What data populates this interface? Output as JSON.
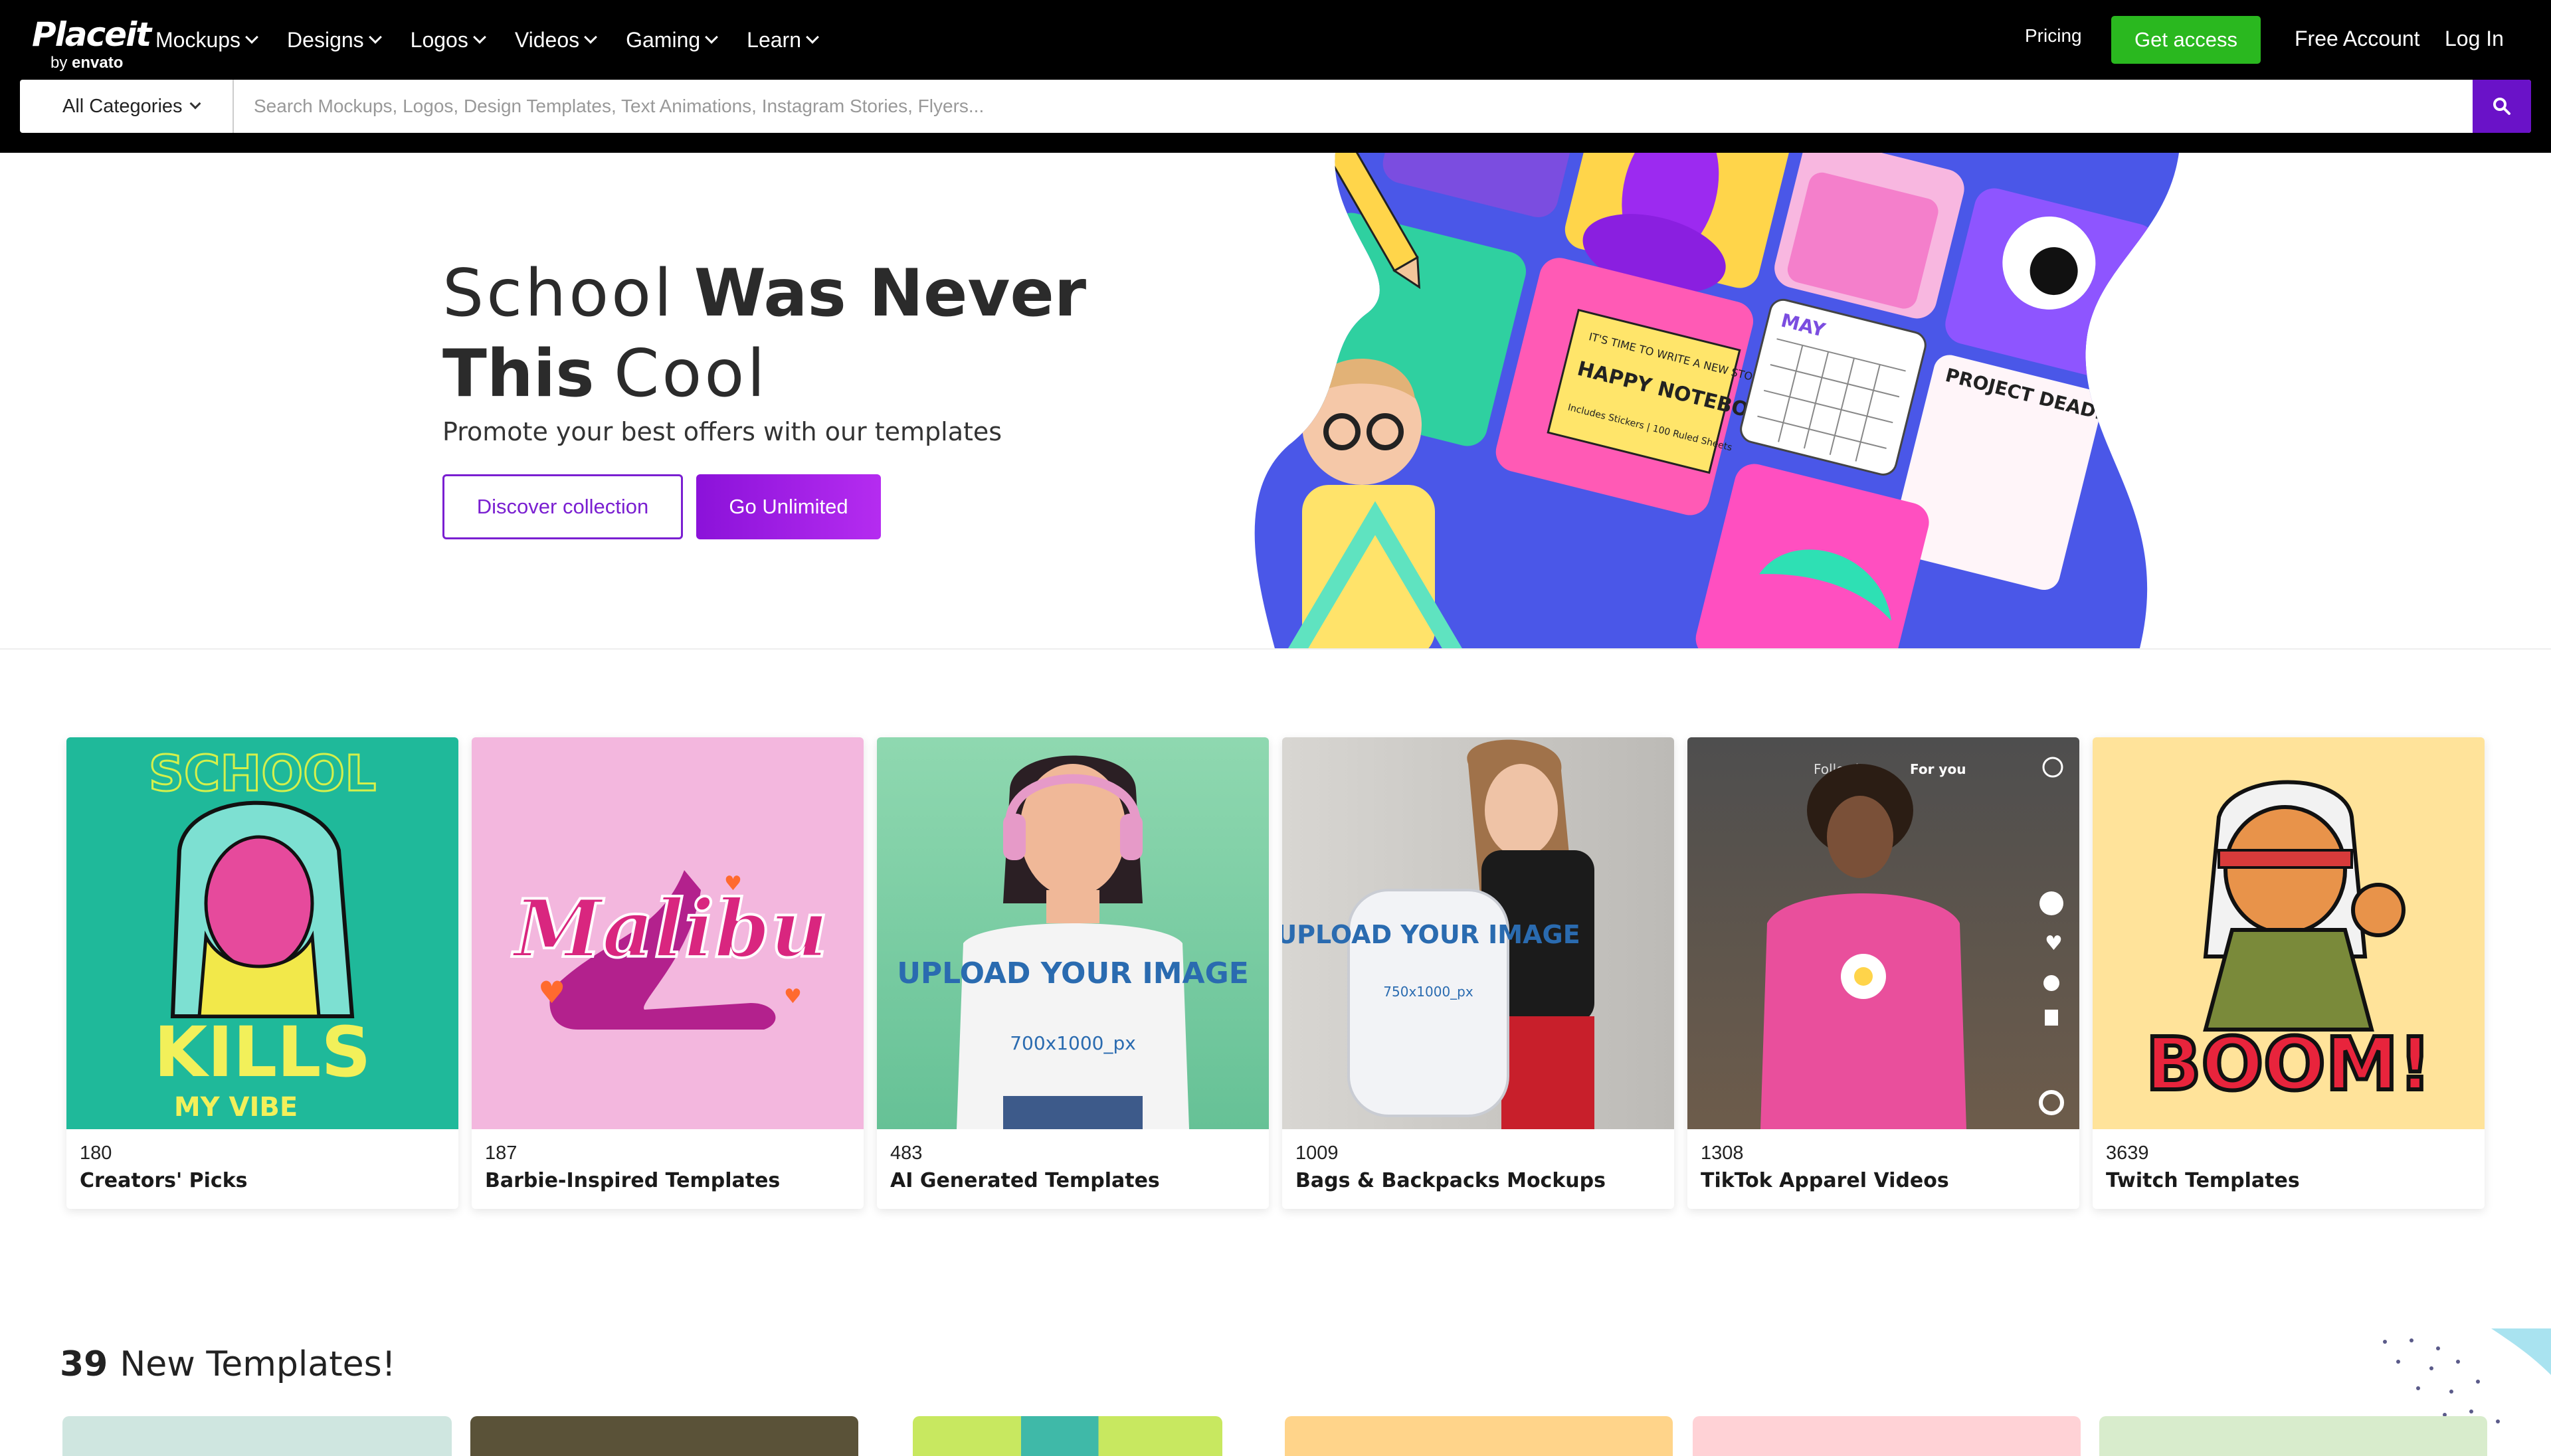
{
  "header": {
    "logo_main": "Placeit",
    "logo_by": "by",
    "logo_brand": "envato",
    "nav": [
      {
        "label": "Mockups"
      },
      {
        "label": "Designs"
      },
      {
        "label": "Logos"
      },
      {
        "label": "Videos"
      },
      {
        "label": "Gaming"
      },
      {
        "label": "Learn"
      }
    ],
    "pricing": "Pricing",
    "get_access": "Get access",
    "free_account": "Free Account",
    "login": "Log In"
  },
  "search": {
    "category": "All Categories",
    "placeholder": "Search Mockups, Logos, Design Templates, Text Animations, Instagram Stories, Flyers..."
  },
  "hero": {
    "title_light_1": "School",
    "title_bold_1": "Was Never",
    "title_bold_2": "This",
    "title_light_2": "Cool",
    "subtitle": "Promote your best offers with our templates",
    "btn_discover": "Discover collection",
    "btn_unlimited": "Go Unlimited",
    "art_labels": {
      "notebook_1": "IT'S TIME TO WRITE A NEW STORY",
      "notebook_2": "HAPPY NOTEBOOK",
      "notebook_3": "Includes Stickers | 100 Ruled Sheets",
      "calendar": "MAY",
      "project": "PROJECT DEADLINE"
    }
  },
  "categories": [
    {
      "count": "180",
      "name": "Creators' Picks",
      "art_top": "SCHOOL",
      "art_main": "KILLS",
      "art_sub": "MY VIBE"
    },
    {
      "count": "187",
      "name": "Barbie-Inspired Templates",
      "art_main": "Malibu"
    },
    {
      "count": "483",
      "name": "AI Generated Templates",
      "art_main": "UPLOAD YOUR IMAGE",
      "art_sub": "700x1000_px"
    },
    {
      "count": "1009",
      "name": "Bags & Backpacks Mockups",
      "art_main": "UPLOAD YOUR IMAGE",
      "art_sub": "750x1000_px"
    },
    {
      "count": "1308",
      "name": "TikTok Apparel Videos",
      "art_main": "Following",
      "art_sub": "For you"
    },
    {
      "count": "3639",
      "name": "Twitch Templates",
      "art_main": "BOOM!"
    }
  ],
  "new_templates": {
    "count": "39",
    "label": "New Templates!"
  },
  "colors": {
    "brand_green": "#2ab81f",
    "brand_purple": "#7a1fd1",
    "search_button": "#6a12c8"
  }
}
